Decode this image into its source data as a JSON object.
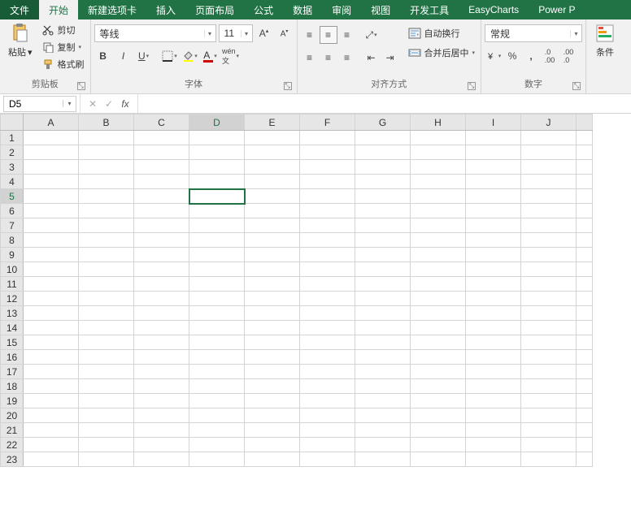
{
  "menu": {
    "tabs": [
      "文件",
      "开始",
      "新建选项卡",
      "插入",
      "页面布局",
      "公式",
      "数据",
      "审阅",
      "视图",
      "开发工具",
      "EasyCharts",
      "Power P"
    ],
    "active": 1
  },
  "ribbon": {
    "clipboard": {
      "title": "剪贴板",
      "paste": "粘贴",
      "cut": "剪切",
      "copy": "复制",
      "format_painter": "格式刷"
    },
    "font": {
      "title": "字体",
      "name": "等线",
      "size": "11"
    },
    "align": {
      "title": "对齐方式",
      "wrap": "自动换行",
      "merge": "合并后居中"
    },
    "number": {
      "title": "数字",
      "format": "常规",
      "percent": "%",
      "comma": ","
    },
    "cond": "条件"
  },
  "namebox": "D5",
  "formula": "",
  "grid": {
    "cols": [
      "A",
      "B",
      "C",
      "D",
      "E",
      "F",
      "G",
      "H",
      "I",
      "J"
    ],
    "rows": 23,
    "selected": {
      "col": "D",
      "row": 5
    }
  }
}
